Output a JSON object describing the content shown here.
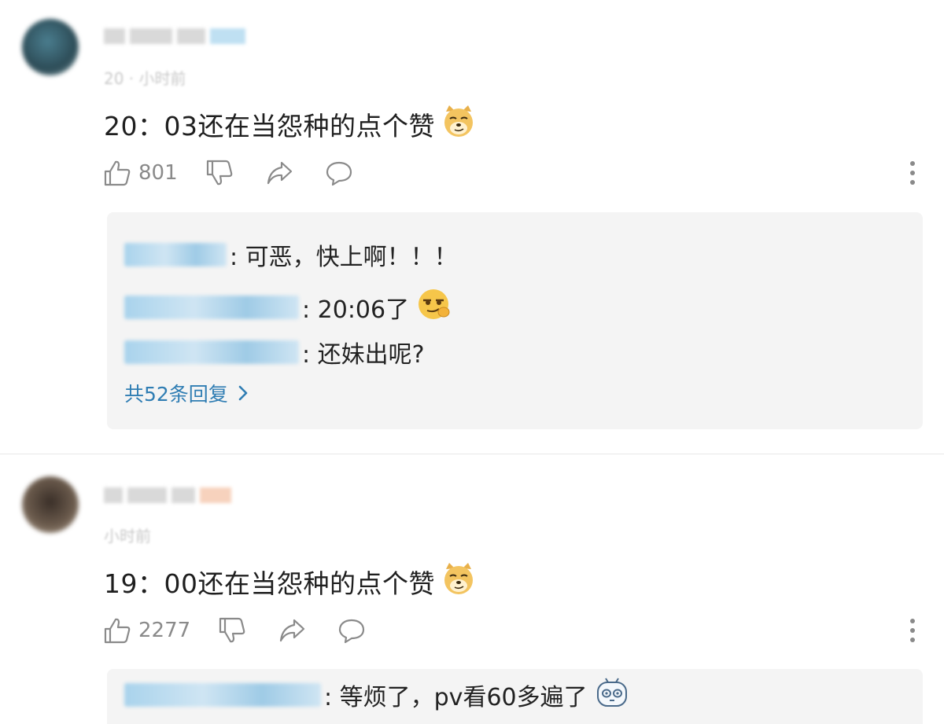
{
  "comments": [
    {
      "time_label": "20 · 小时前",
      "text": "20：03还在当怨种的点个赞",
      "emoji_icon": "doge-emoji-icon",
      "likes": "801",
      "replies": [
        {
          "text": ": 可恶，快上啊！！！"
        },
        {
          "text": ": 20:06了",
          "emoji_icon": "sly-emoji-icon"
        },
        {
          "text": ": 还妹出呢?"
        }
      ],
      "total_replies": "共52条回复"
    },
    {
      "time_label": "小时前",
      "text": "19：00还在当怨种的点个赞",
      "emoji_icon": "doge-emoji-icon",
      "likes": "2277",
      "replies": [
        {
          "text": ": 等烦了，pv看60多遍了",
          "emoji_icon": "tv-mascot-emoji-icon"
        }
      ]
    }
  ],
  "colors": {
    "link": "#2f7db3",
    "reply_bg": "#f4f4f4",
    "icon": "#8a8a8a"
  }
}
